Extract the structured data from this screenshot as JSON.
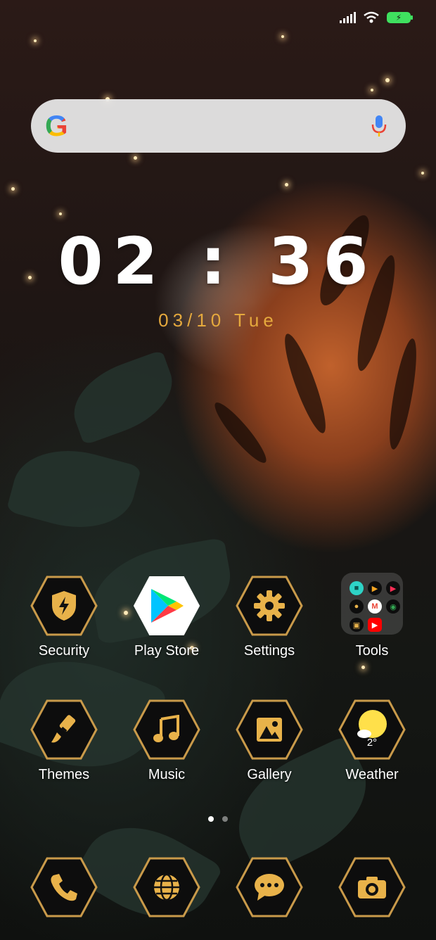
{
  "status_bar": {
    "signal_icon": "signal-bars-icon",
    "wifi_icon": "wifi-icon",
    "battery_icon": "battery-charging-icon"
  },
  "search_bar": {
    "logo": "G",
    "mic_icon": "microphone-icon"
  },
  "clock": {
    "time": "02 : 36",
    "date": "03/10  Tue"
  },
  "apps_row1": [
    {
      "label": "Security",
      "icon": "shield-bolt-icon"
    },
    {
      "label": "Play Store",
      "icon": "play-store-icon"
    },
    {
      "label": "Settings",
      "icon": "gear-icon"
    },
    {
      "label": "Tools",
      "icon": "folder-icon"
    }
  ],
  "apps_row2": [
    {
      "label": "Themes",
      "icon": "paintbrush-icon"
    },
    {
      "label": "Music",
      "icon": "music-note-icon"
    },
    {
      "label": "Gallery",
      "icon": "image-icon"
    },
    {
      "label": "Weather",
      "icon": "sun-icon",
      "temp": "2°"
    }
  ],
  "dock": [
    {
      "icon": "phone-icon"
    },
    {
      "icon": "globe-icon"
    },
    {
      "icon": "chat-bubble-icon"
    },
    {
      "icon": "camera-icon"
    }
  ],
  "page_indicator": {
    "pages": 2,
    "active": 1
  },
  "colors": {
    "accent_gold": "#e8b24a",
    "date_color": "#e5a93d",
    "battery_green": "#3fe05f"
  }
}
